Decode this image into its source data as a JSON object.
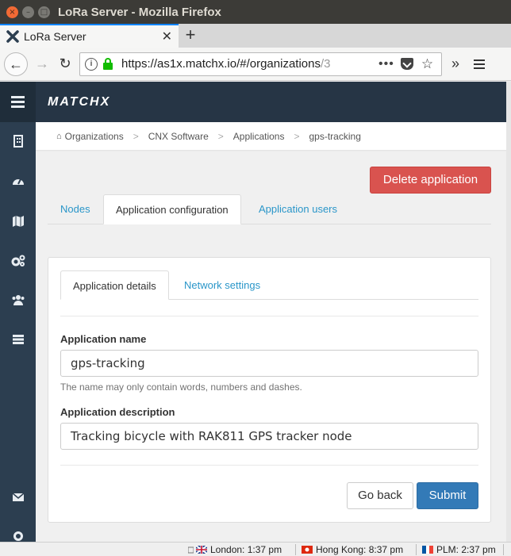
{
  "window": {
    "title": "LoRa Server - Mozilla Firefox"
  },
  "browser": {
    "tab_title": "LoRa Server",
    "url_main": "https://as1x.matchx.io/#/organizations",
    "url_dim": "/3"
  },
  "app": {
    "logo": "MATCHX",
    "breadcrumb": [
      "Organizations",
      "CNX Software",
      "Applications",
      "gps-tracking"
    ],
    "sidebar_icons": [
      "building-icon",
      "dashboard-icon",
      "map-icon",
      "gears-icon",
      "users-icon",
      "server-icon",
      "envelope-icon",
      "gear-icon"
    ]
  },
  "page": {
    "delete_label": "Delete application",
    "tabs": [
      "Nodes",
      "Application configuration",
      "Application users"
    ],
    "subtabs": [
      "Application details",
      "Network settings"
    ],
    "name_label": "Application name",
    "name_value": "gps-tracking",
    "name_help": "The name may only contain words, numbers and dashes.",
    "desc_label": "Application description",
    "desc_value": "Tracking bicycle with RAK811 GPS tracker node",
    "back_label": "Go back",
    "submit_label": "Submit"
  },
  "statusbar": {
    "clocks": [
      "London: 1:37 pm",
      "Hong Kong: 8:37 pm",
      "PLM: 2:37 pm"
    ]
  },
  "colors": {
    "danger": "#d9534f",
    "primary": "#337ab7",
    "link": "#2a96c9",
    "sidebar": "#2c3e50"
  }
}
